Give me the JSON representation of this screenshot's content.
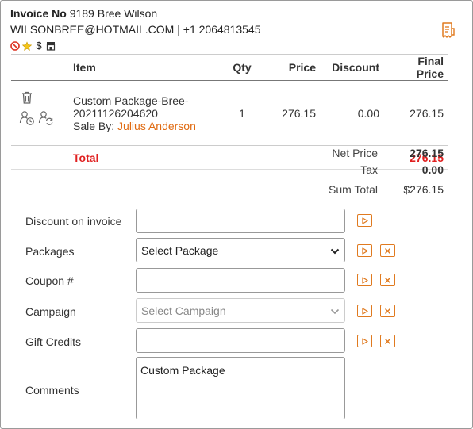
{
  "invoice": {
    "no_label": "Invoice No",
    "number": "9189",
    "customer_name": "Bree Wilson",
    "email": "WILSONBREE@HOTMAIL.COM",
    "separator": "|",
    "phone": "+1 2064813545",
    "badges": {
      "currency": "$"
    }
  },
  "table": {
    "headers": {
      "item": "Item",
      "qty": "Qty",
      "price": "Price",
      "discount": "Discount",
      "final_price": "Final Price"
    },
    "rows": [
      {
        "item_line1": "Custom Package-Bree-",
        "item_line2": "20211126204620",
        "sale_by_label": "Sale By:",
        "sale_by_name": "Julius Anderson",
        "qty": "1",
        "price": "276.15",
        "discount": "0.00",
        "final_price": "276.15"
      }
    ],
    "total_label": "Total",
    "total_value": "276.15"
  },
  "summary": {
    "net_price_label": "Net Price",
    "net_price_value": "276.15",
    "tax_label": "Tax",
    "tax_value": "0.00",
    "sum_total_label": "Sum Total",
    "sum_total_value": "$276.15"
  },
  "form": {
    "discount_label": "Discount on invoice",
    "discount_value": "",
    "packages_label": "Packages",
    "packages_selected": "Select Package",
    "coupon_label": "Coupon #",
    "coupon_value": "",
    "campaign_label": "Campaign",
    "campaign_placeholder": "Select Campaign",
    "gift_label": "Gift Credits",
    "gift_value": "",
    "comments_label": "Comments",
    "comments_value": "Custom Package"
  },
  "colors": {
    "accent": "#e07a1f",
    "total_red": "#e02020",
    "sale_by": "#e06a10"
  },
  "icons": [
    "receipt-icon",
    "no-sign-icon",
    "star-icon",
    "store-icon",
    "trash-icon",
    "user-clock-icon",
    "user-refresh-icon",
    "apply-icon",
    "remove-icon",
    "chevron-down-icon"
  ]
}
